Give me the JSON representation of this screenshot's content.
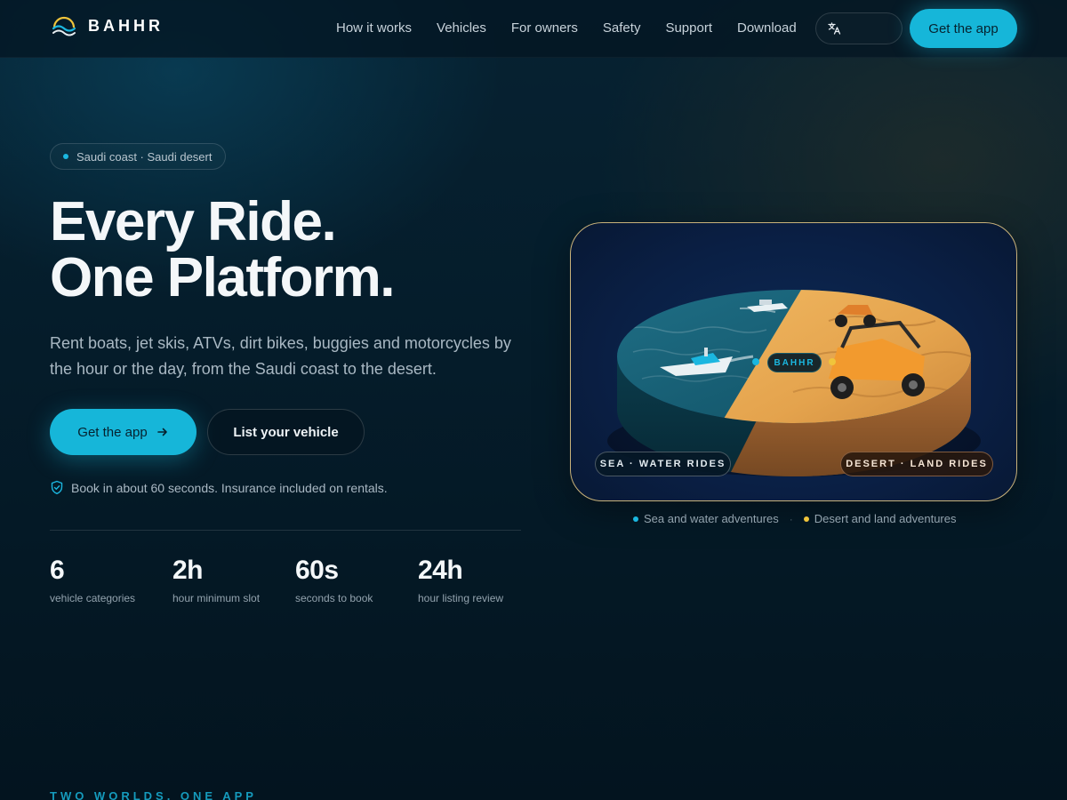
{
  "brand": {
    "name": "BAHHR",
    "logo_icon": "wave-sun-logo-icon"
  },
  "nav": {
    "links": [
      "How it works",
      "Vehicles",
      "For owners",
      "Safety",
      "Support",
      "Download"
    ],
    "language_icon": "translate-icon",
    "cta_label": "Get the app"
  },
  "hero": {
    "tag": "Saudi coast · Saudi desert",
    "headline_line1": "Every Ride.",
    "headline_line2": "One Platform.",
    "subcopy": "Rent boats, jet skis, ATVs, dirt bikes, buggies and motorcycles by the hour or the day, from the Saudi coast to the desert.",
    "primary_cta": "Get the app",
    "primary_cta_icon": "arrow-right-icon",
    "secondary_cta": "List your vehicle",
    "note": "Book in about 60 seconds. Insurance included on rentals.",
    "note_icon": "shield-check-icon",
    "stats": [
      {
        "value": "6",
        "label": "vehicle categories"
      },
      {
        "value": "2h",
        "label": "hour minimum slot"
      },
      {
        "value": "60s",
        "label": "seconds to book"
      },
      {
        "value": "24h",
        "label": "hour listing review"
      }
    ]
  },
  "showcase": {
    "center_badge": "BAHHR",
    "sea_chip": "SEA · WATER RIDES",
    "desert_chip": "DESERT · LAND RIDES",
    "legend_sea": "Sea and water adventures",
    "legend_separator": "·",
    "legend_desert": "Desert and land adventures"
  },
  "next_section": {
    "eyebrow": "TWO WORLDS. ONE APP"
  },
  "colors": {
    "accent": "#16b6d9",
    "desert": "#f0c43b",
    "background": "#051c2a",
    "card_border": "#c9b27a"
  }
}
